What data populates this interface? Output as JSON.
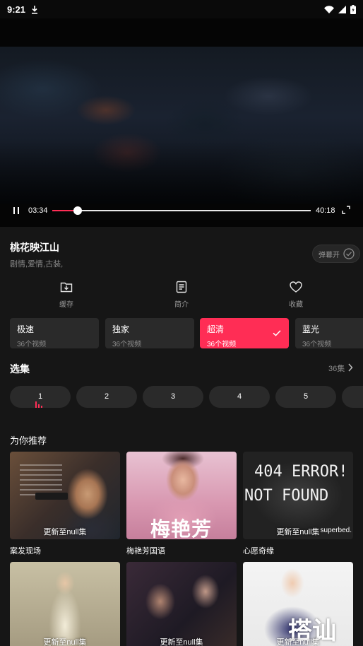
{
  "status_bar": {
    "time": "9:21"
  },
  "player": {
    "current_time": "03:34",
    "total_time": "40:18",
    "progress": 0.099
  },
  "show": {
    "title": "桃花映江山",
    "genres": "剧情,爱情,古装,",
    "danmaku_label": "弹幕开"
  },
  "actions": [
    {
      "label": "缓存",
      "icon": "download-folder-icon"
    },
    {
      "label": "简介",
      "icon": "document-icon"
    },
    {
      "label": "收藏",
      "icon": "heart-icon"
    }
  ],
  "quality": [
    {
      "name": "极速",
      "count": "36个视频",
      "active": false
    },
    {
      "name": "独家",
      "count": "36个视频",
      "active": false
    },
    {
      "name": "超清",
      "count": "36个视频",
      "active": true
    },
    {
      "name": "蓝光",
      "count": "36个视频",
      "active": false
    }
  ],
  "episodes": {
    "title": "选集",
    "count_label": "36集",
    "items": [
      "1",
      "2",
      "3",
      "4",
      "5"
    ],
    "current": "1"
  },
  "recommend": {
    "title": "为你推荐",
    "items": [
      {
        "name": "案发现场",
        "caption": "更新至null集"
      },
      {
        "name": "梅艳芳国语",
        "caption": "",
        "poster_text": "梅艳芳"
      },
      {
        "name": "心愿奇缘",
        "caption": "更新至null集",
        "poster_line1": "404 ERROR!",
        "poster_line2": "NOT FOUND",
        "watermark": "superbed."
      },
      {
        "name": "",
        "caption": "更新至null集"
      },
      {
        "name": "",
        "caption": "更新至null集"
      },
      {
        "name": "",
        "caption": "更新至null集",
        "poster_text": "搭讪"
      }
    ]
  },
  "colors": {
    "accent": "#ff2d55",
    "background": "#161616",
    "card": "#2a2a2a"
  }
}
